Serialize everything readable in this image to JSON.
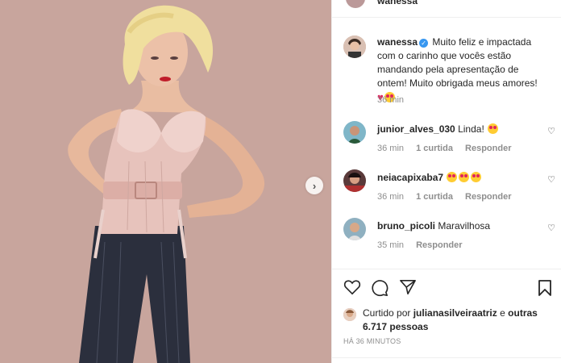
{
  "post": {
    "top_username": "wanessa",
    "caption_user": "wanessa",
    "caption_text": "Muito feliz e impactada com o carinho que vocês estão mandando pela apresentação de ontem! Muito obrigada meus amores!",
    "caption_time": "36 min"
  },
  "comments": [
    {
      "user": "junior_alves_030",
      "text": "Linda!",
      "time": "36 min",
      "likes": "1 curtida",
      "reply": "Responder",
      "emoji_count": 1
    },
    {
      "user": "neiacapixaba7",
      "text": "",
      "time": "36 min",
      "likes": "1 curtida",
      "reply": "Responder",
      "emoji_count": 3
    },
    {
      "user": "bruno_picoli",
      "text": "Maravilhosa",
      "time": "35 min",
      "likes": "",
      "reply": "Responder",
      "emoji_count": 0
    }
  ],
  "likes": {
    "prefix": "Curtido por",
    "user": "julianasilveiraatriz",
    "middle": "e",
    "others": "outras 6.717 pessoas"
  },
  "timestamp": "HÁ 36 MINUTOS",
  "icons": {
    "like": "heart-icon",
    "comment": "comment-icon",
    "share": "send-icon",
    "save": "bookmark-icon",
    "next": "chevron-right-icon"
  },
  "colors": {
    "verified": "#3897f0",
    "background_media": "#c9a8a0",
    "meta_text": "#8e8e8e"
  }
}
